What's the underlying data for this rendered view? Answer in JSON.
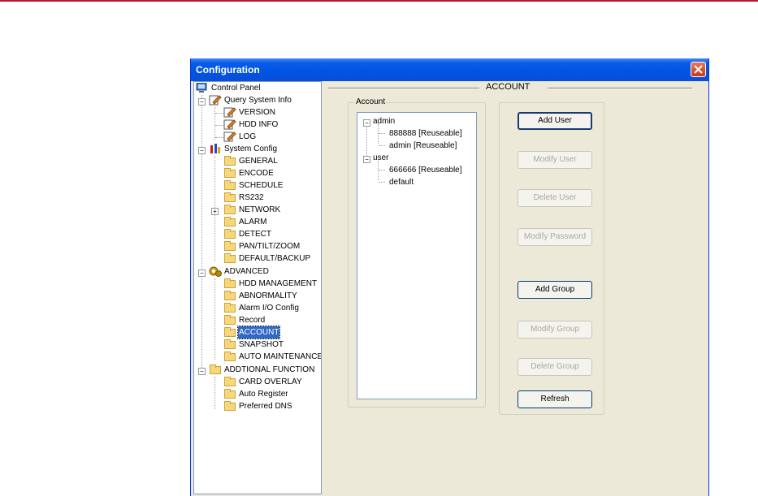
{
  "window": {
    "title": "Configuration"
  },
  "tree": {
    "root": "Control Panel",
    "query": {
      "label": "Query System Info",
      "items": [
        "VERSION",
        "HDD INFO",
        "LOG"
      ]
    },
    "system": {
      "label": "System Config",
      "items": [
        "GENERAL",
        "ENCODE",
        "SCHEDULE",
        "RS232",
        "NETWORK",
        "ALARM",
        "DETECT",
        "PAN/TILT/ZOOM",
        "DEFAULT/BACKUP"
      ]
    },
    "advanced": {
      "label": "ADVANCED",
      "items": [
        "HDD MANAGEMENT",
        "ABNORMALITY",
        "Alarm I/O Config",
        "Record",
        "ACCOUNT",
        "SNAPSHOT",
        "AUTO MAINTENANCE"
      ]
    },
    "additional": {
      "label": "ADDTIONAL FUNCTION",
      "items": [
        "CARD OVERLAY",
        "Auto Register",
        "Preferred DNS"
      ]
    },
    "selected": "ACCOUNT"
  },
  "panel": {
    "title": "ACCOUNT",
    "account_group_label": "Account",
    "accounts": [
      {
        "group": "admin",
        "users": [
          "888888 [Reuseable]",
          "admin [Reuseable]"
        ]
      },
      {
        "group": "user",
        "users": [
          "666666 [Reuseable]",
          "default"
        ]
      }
    ],
    "buttons": {
      "add_user": "Add User",
      "modify_user": "Modify User",
      "delete_user": "Delete User",
      "modify_password": "Modify Password",
      "add_group": "Add Group",
      "modify_group": "Modify Group",
      "delete_group": "Delete Group",
      "refresh": "Refresh"
    }
  },
  "colors": {
    "titlebar": "#0054e3",
    "selection": "#316ac5",
    "top_line": "#c8102e"
  }
}
